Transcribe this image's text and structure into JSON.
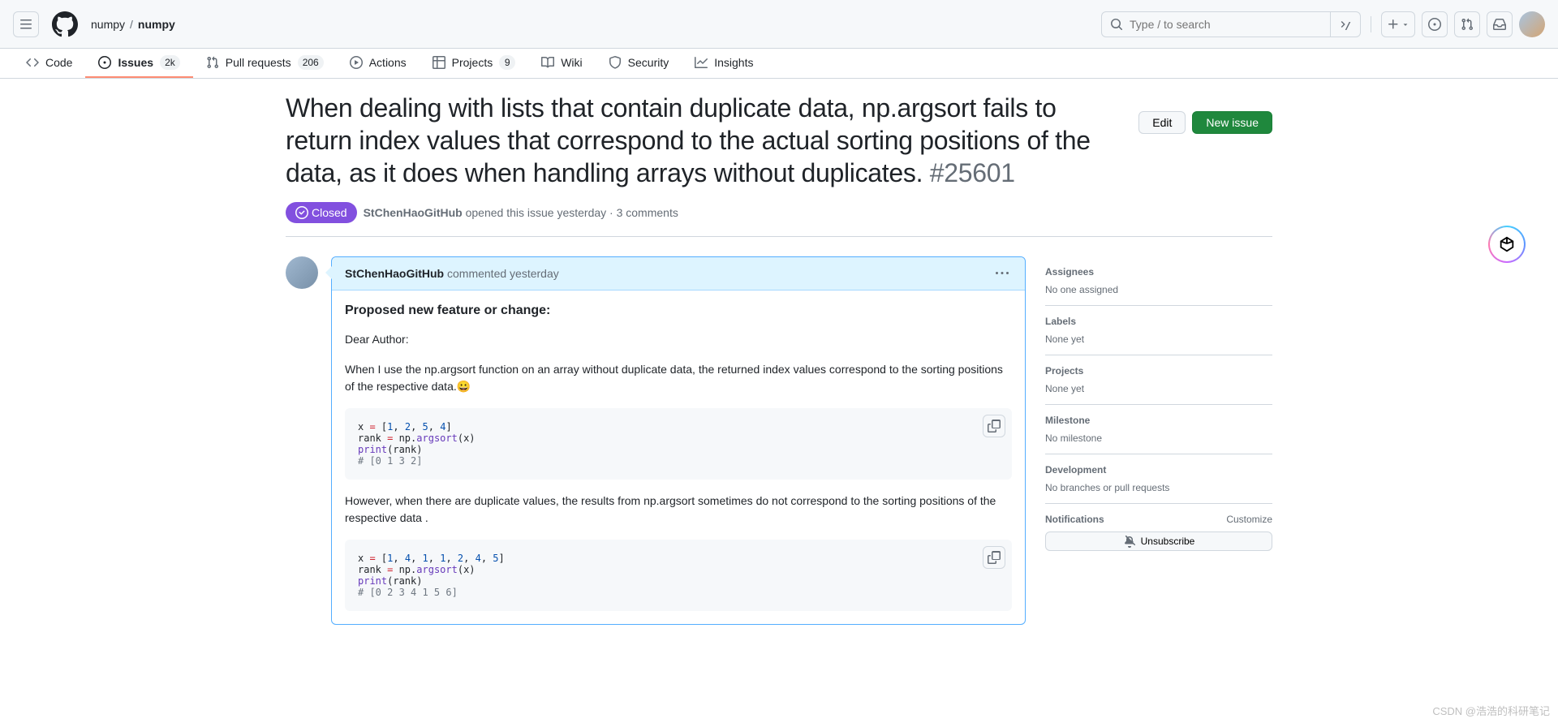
{
  "header": {
    "owner": "numpy",
    "repo": "numpy",
    "search_placeholder": "Type / to search"
  },
  "nav": {
    "tabs": [
      {
        "label": "Code",
        "count": null
      },
      {
        "label": "Issues",
        "count": "2k"
      },
      {
        "label": "Pull requests",
        "count": "206"
      },
      {
        "label": "Actions",
        "count": null
      },
      {
        "label": "Projects",
        "count": "9"
      },
      {
        "label": "Wiki",
        "count": null
      },
      {
        "label": "Security",
        "count": null
      },
      {
        "label": "Insights",
        "count": null
      }
    ]
  },
  "issue": {
    "title": "When dealing with lists that contain duplicate data, np.argsort fails to return index values that correspond to the actual sorting positions of the data, as it does when handling arrays without duplicates.",
    "number": "#25601",
    "state": "Closed",
    "author": "StChenHaoGitHub",
    "opened_text": "opened this issue yesterday · 3 comments",
    "edit_label": "Edit",
    "new_issue_label": "New issue"
  },
  "comment": {
    "author": "StChenHaoGitHub",
    "time_text": "commented yesterday",
    "heading": "Proposed new feature or change:",
    "p1": "Dear Author:",
    "p2": "When I use the np.argsort function on an array without duplicate data, the returned index values correspond to the sorting positions of the respective data.",
    "emoji1": "😀",
    "code1": "x = [1, 2, 5, 4]\nrank = np.argsort(x)\nprint(rank)\n# [0 1 3 2]",
    "p3": "However, when there are duplicate values, the results from np.argsort sometimes do not correspond to the sorting positions of the respective data .",
    "code2": "x = [1, 4, 1, 1, 2, 4, 5]\nrank = np.argsort(x)\nprint(rank)\n# [0 2 3 4 1 5 6]"
  },
  "sidebar": {
    "assignees": {
      "title": "Assignees",
      "value": "No one assigned"
    },
    "labels": {
      "title": "Labels",
      "value": "None yet"
    },
    "projects": {
      "title": "Projects",
      "value": "None yet"
    },
    "milestone": {
      "title": "Milestone",
      "value": "No milestone"
    },
    "development": {
      "title": "Development",
      "value": "No branches or pull requests"
    },
    "notifications": {
      "title": "Notifications",
      "customize": "Customize",
      "unsubscribe": "Unsubscribe"
    }
  },
  "watermark": "CSDN @浩浩的科研笔记"
}
